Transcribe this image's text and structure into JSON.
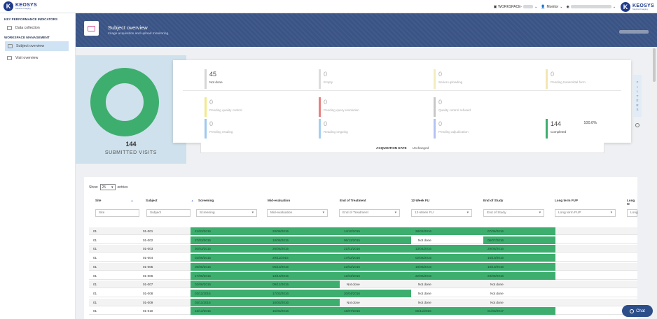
{
  "brand": {
    "name": "KEOSYS",
    "tagline": "Medical Imaging"
  },
  "topbar": {
    "workspace": "WORKSPACE-",
    "role": "Monitor"
  },
  "sidebar": {
    "section1": "KEY PERFORMANCE INDICATORS",
    "section1_items": [
      {
        "label": "Data collection"
      }
    ],
    "section2": "WORKSPACE MANAGEMENT",
    "section2_items": [
      {
        "label": "Subject overview"
      },
      {
        "label": "Visit overview"
      }
    ]
  },
  "header": {
    "title": "Subject overview",
    "subtitle": "Image acquisition and upload monitoring."
  },
  "donut": {
    "count": "144",
    "label": "SUBMITTED VISITS",
    "completed_fraction": 1.0,
    "color": "#3dae6e"
  },
  "status_cards": [
    {
      "num": "45",
      "label": "Not done",
      "color": "#d6d6d6"
    },
    {
      "num": "0",
      "label": "Empty",
      "color": "#dcdcdc"
    },
    {
      "num": "0",
      "label": "Series uploading",
      "color": "#f3ecc0"
    },
    {
      "num": "0",
      "label": "Pending transmittal form",
      "color": "#f3e6b0"
    },
    {
      "num": "0",
      "label": "Pending quality control",
      "color": "#f2ea8a"
    },
    {
      "num": "0",
      "label": "Pending query resolution",
      "color": "#e88080"
    },
    {
      "num": "0",
      "label": "Quality control refused",
      "color": "#c8c8c8"
    },
    {
      "num": "0",
      "label": "Pending reading",
      "color": "#9cc9ef"
    },
    {
      "num": "0",
      "label": "Reading ongoing",
      "color": "#a6cff0"
    },
    {
      "num": "0",
      "label": "Pending adjudication",
      "color": "#b4c3f2"
    },
    {
      "num": "144",
      "label": "Completed",
      "pct": "100.0%",
      "color": "#3dae6e"
    }
  ],
  "filters_tab": {
    "letters": [
      "F",
      "I",
      "L",
      "T",
      "E",
      "R",
      "S"
    ]
  },
  "acquisition": {
    "key": "ACQUISITION DATE",
    "value": "Unchanged"
  },
  "table": {
    "show_label": "Show",
    "page_size": "25",
    "entries_label": "entries",
    "columns": [
      "Site",
      "Subject",
      "Screening",
      "Mid-evaluation",
      "End of Treatment",
      "12-Week FU",
      "End of Study",
      "Long term FUP",
      "Long te"
    ],
    "filters": [
      "Site",
      "Subject",
      "Screening",
      "Mid-evaluation",
      "End of Treatment",
      "12-Week FU",
      "End of Study",
      "Long term FUP",
      "Long"
    ],
    "rows": [
      {
        "site": "01",
        "subject": "01-001",
        "scr": "21/03/2015",
        "mid": "20/08/2015",
        "eot": "14/10/2015",
        "fu12": "28/02/2016",
        "eos": "07/06/2016"
      },
      {
        "site": "01",
        "subject": "01-002",
        "scr": "27/03/2015",
        "mid": "10/08/2015",
        "eot": "06/12/2015",
        "fu12": "Not done",
        "eos": "06/07/2016"
      },
      {
        "site": "01",
        "subject": "01-003",
        "scr": "30/03/2015",
        "mid": "26/08/2015",
        "eot": "21/01/2016",
        "fu12": "13/04/2016",
        "eos": "29/08/2016"
      },
      {
        "site": "01",
        "subject": "01-004",
        "scr": "02/06/2015",
        "mid": "29/11/2015",
        "eot": "17/02/2016",
        "fu12": "02/06/2016",
        "eos": "16/10/2016"
      },
      {
        "site": "01",
        "subject": "01-005",
        "scr": "08/05/2015",
        "mid": "05/10/2015",
        "eot": "22/02/2016",
        "fu12": "18/06/2016",
        "eos": "18/10/2016"
      },
      {
        "site": "01",
        "subject": "01-006",
        "scr": "17/05/2015",
        "mid": "13/10/2015",
        "eot": "12/03/2016",
        "fu12": "22/06/2016",
        "eos": "23/09/2016"
      },
      {
        "site": "01",
        "subject": "01-007",
        "scr": "02/06/2015",
        "mid": "09/12/2015",
        "eot": "Not done",
        "fu12": "Not done",
        "eos": "Not done"
      },
      {
        "site": "01",
        "subject": "01-008",
        "scr": "02/11/2015",
        "mid": "17/03/2016",
        "eot": "20/04/2016",
        "fu12": "Not done",
        "eos": "Not done"
      },
      {
        "site": "01",
        "subject": "01-009",
        "scr": "03/11/2015",
        "mid": "16/03/2016",
        "eot": "Not done",
        "fu12": "Not done",
        "eos": "Not done"
      },
      {
        "site": "01",
        "subject": "01-010",
        "scr": "16/12/2015",
        "mid": "15/03/2016",
        "eot": "16/07/2016",
        "fu12": "06/11/2016",
        "eos": "01/03/2017"
      }
    ]
  },
  "chat": {
    "label": "Chat"
  }
}
